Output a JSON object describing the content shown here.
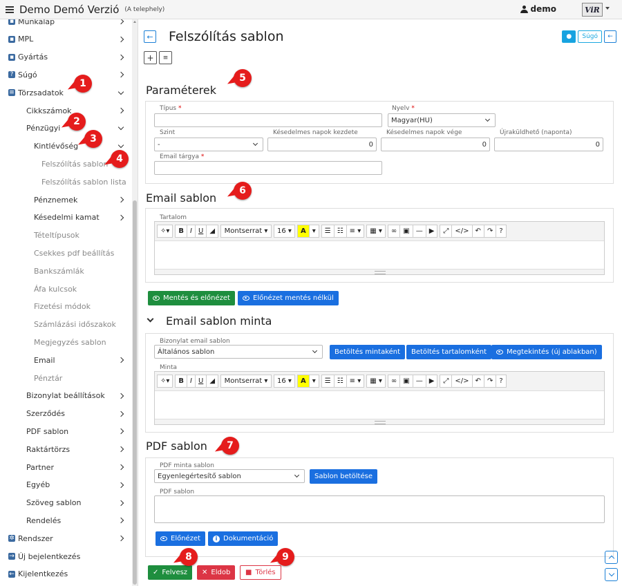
{
  "app": {
    "title": "Demo Demó Verzió",
    "subtitle": "(A telephely)",
    "user": "demo",
    "logo_text": "ViR"
  },
  "sidebar": {
    "items": [
      {
        "label": "Munkalap",
        "level": 0,
        "chevron": "right",
        "icon": "worksheet-icon"
      },
      {
        "label": "MPL",
        "level": 0,
        "chevron": "right",
        "icon": "mpl-icon"
      },
      {
        "label": "Gyártás",
        "level": 0,
        "chevron": "right",
        "icon": "production-icon"
      },
      {
        "label": "Súgó",
        "level": 0,
        "chevron": "right",
        "icon": "help-icon"
      },
      {
        "label": "Törzsadatok",
        "level": 0,
        "chevron": "down",
        "icon": "database-icon"
      },
      {
        "label": "Cikkszámok",
        "level": 1,
        "chevron": "right"
      },
      {
        "label": "Pénzügyi",
        "level": 1,
        "chevron": "down"
      },
      {
        "label": "Kintlévőség",
        "level": 2,
        "chevron": "down"
      },
      {
        "label": "Felszólítás sablon",
        "level": 3,
        "muted": true
      },
      {
        "label": "Felszólítás sablon lista",
        "level": 3,
        "muted": true
      },
      {
        "label": "Pénznemek",
        "level": 2,
        "chevron": "right"
      },
      {
        "label": "Késedelmi kamat",
        "level": 2,
        "chevron": "right"
      },
      {
        "label": "Tételtípusok",
        "level": 2,
        "muted": true
      },
      {
        "label": "Csekkes pdf beállítás",
        "level": 2,
        "muted": true
      },
      {
        "label": "Bankszámlák",
        "level": 2,
        "muted": true
      },
      {
        "label": "Áfa kulcsok",
        "level": 2,
        "muted": true
      },
      {
        "label": "Fizetési módok",
        "level": 2,
        "muted": true
      },
      {
        "label": "Számlázási időszakok",
        "level": 2,
        "muted": true
      },
      {
        "label": "Megjegyzés sablon",
        "level": 2,
        "muted": true
      },
      {
        "label": "Email",
        "level": 2,
        "chevron": "right"
      },
      {
        "label": "Pénztár",
        "level": 2,
        "muted": true
      },
      {
        "label": "Bizonylat beállítások",
        "level": 1,
        "chevron": "right"
      },
      {
        "label": "Szerződés",
        "level": 1,
        "chevron": "right"
      },
      {
        "label": "PDF sablon",
        "level": 1,
        "chevron": "right"
      },
      {
        "label": "Raktártörzs",
        "level": 1,
        "chevron": "right"
      },
      {
        "label": "Partner",
        "level": 1,
        "chevron": "right"
      },
      {
        "label": "Egyéb",
        "level": 1,
        "chevron": "right"
      },
      {
        "label": "Szöveg sablon",
        "level": 1,
        "chevron": "right"
      },
      {
        "label": "Rendelés",
        "level": 1,
        "chevron": "right"
      },
      {
        "label": "Rendszer",
        "level": 0,
        "chevron": "right",
        "icon": "gears-icon"
      },
      {
        "label": "Új bejelentkezés",
        "level": 0,
        "icon": "login-icon"
      },
      {
        "label": "Kijelentkezés",
        "level": 0,
        "icon": "logout-icon"
      }
    ]
  },
  "header": {
    "title": "Felszólítás sablon",
    "help_label": "Súgó"
  },
  "params": {
    "title": "Paraméterek",
    "tipus_label": "Típus",
    "tipus_value": "",
    "nyelv_label": "Nyelv",
    "nyelv_value": "Magyar(HU)",
    "szint_label": "Szint",
    "szint_value": "-",
    "kes_kezd_label": "Késedelmes napok kezdete",
    "kes_kezd_value": "0",
    "kes_vege_label": "Késedelmes napok vége",
    "kes_vege_value": "0",
    "ujra_label": "Újraküldhető (naponta)",
    "ujra_value": "0",
    "email_targy_label": "Email tárgya",
    "email_targy_value": ""
  },
  "email_sablon": {
    "title": "Email sablon",
    "tartalom_label": "Tartalom",
    "save_preview": "Mentés és előnézet",
    "preview_nosave": "Előnézet mentés nélkül"
  },
  "editor_toolbar": {
    "font": "Montserrat",
    "size": "16"
  },
  "email_minta": {
    "title": "Email sablon minta",
    "biz_label": "Bizonylat email sablon",
    "biz_value": "Általános sablon",
    "load_sample": "Betöltés mintaként",
    "load_content": "Betöltés tartalomként",
    "view_new": "Megtekintés (új ablakban)",
    "minta_label": "Minta"
  },
  "pdf": {
    "title": "PDF sablon",
    "minta_label": "PDF minta sablon",
    "minta_value": "Egyenlegértesítő sablon",
    "load_btn": "Sablon betöltése",
    "pdf_label": "PDF sablon",
    "preview": "Előnézet",
    "docs": "Dokumentáció"
  },
  "footer": {
    "add": "Felvesz",
    "discard": "Eldob",
    "delete": "Törlés"
  },
  "badges": [
    "1",
    "2",
    "3",
    "4",
    "5",
    "6",
    "7",
    "8",
    "9"
  ],
  "colors": {
    "badge": "#e51c1c",
    "primary": "#1a6fe0",
    "success": "#1e8e3e",
    "danger": "#dc3545"
  }
}
